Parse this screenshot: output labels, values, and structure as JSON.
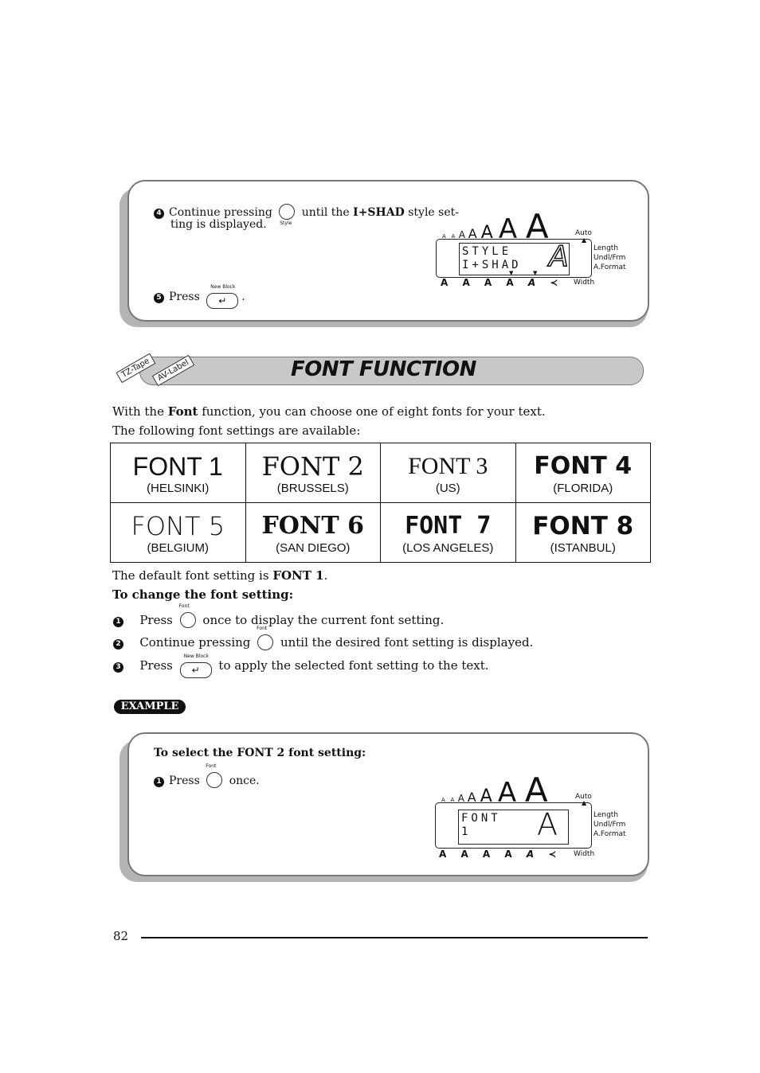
{
  "step_box": {
    "step4": {
      "num": "4",
      "pre": "Continue pressing",
      "key": "Style",
      "post": "until the",
      "bold": "I+SHAD",
      "post2": "style set-",
      "line2": "ting is displayed."
    },
    "step5": {
      "num": "5",
      "pre": "Press",
      "key": "New Block",
      "post": "."
    },
    "lcd": {
      "line1": "STYLE",
      "line2": "I+SHAD",
      "glyph": "A",
      "auto": "Auto",
      "length": "Length",
      "undl": "Undl/Frm",
      "aformat": "A.Format",
      "width": "Width"
    }
  },
  "section": {
    "title": "FONT FUNCTION",
    "tags": [
      "TZ-Tape",
      "AV-Label"
    ]
  },
  "intro": {
    "pre": "With the",
    "bold": "Font",
    "post": "function, you can choose one of eight fonts for your text.",
    "line2": "The following font settings are available:"
  },
  "fonts": [
    {
      "name": "FONT 1",
      "city": "(HELSINKI)"
    },
    {
      "name": "FONT 2",
      "city": "(BRUSSELS)"
    },
    {
      "name": "FONT 3",
      "city": "(US)"
    },
    {
      "name": "FONT 4",
      "city": "(FLORIDA)"
    },
    {
      "name": "FONT 5",
      "city": "(BELGIUM)"
    },
    {
      "name": "FONT 6",
      "city": "(SAN DIEGO)"
    },
    {
      "name": "FONT 7",
      "city": "(LOS ANGELES)"
    },
    {
      "name": "FONT 8",
      "city": "(ISTANBUL)"
    }
  ],
  "default": {
    "pre": "The default font setting is",
    "bold": "FONT 1",
    "post": "."
  },
  "change_heading": "To change the font setting:",
  "steps": [
    {
      "num": "1",
      "pre": "Press",
      "key": "Font",
      "post": "once to display the current font setting."
    },
    {
      "num": "2",
      "pre": "Continue pressing",
      "key": "Font",
      "post": "until the desired font setting is displayed."
    },
    {
      "num": "3",
      "pre": "Press",
      "key": "New Block",
      "post": "to apply the selected font setting to the text."
    }
  ],
  "example_label": "EXAMPLE",
  "example_box": {
    "heading": "To select the FONT 2 font setting:",
    "step1": {
      "num": "1",
      "pre": "Press",
      "key": "Font",
      "post": "once."
    },
    "lcd": {
      "line1": "FONT",
      "line2": "1",
      "glyph": "A",
      "auto": "Auto",
      "length": "Length",
      "undl": "Undl/Frm",
      "aformat": "A.Format",
      "width": "Width"
    }
  },
  "page_number": "82"
}
